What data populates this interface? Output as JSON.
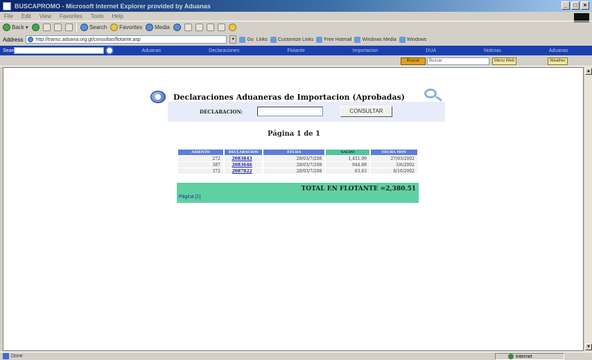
{
  "window": {
    "title": "BUSCAPROMO - Microsoft Internet Explorer provided by Aduanas"
  },
  "menu": [
    "File",
    "Edit",
    "View",
    "Favorites",
    "Tools",
    "Help"
  ],
  "toolbar": {
    "back_label": "Back",
    "search_label": "Search",
    "favorites_label": "Favorites",
    "media_label": "Media"
  },
  "address": {
    "label": "Address",
    "url": "http://transc.aduana.org.gt/consultas/flotante.asp",
    "go_label": "Go",
    "links_label": "Links",
    "links": [
      "Customize Links",
      "Free Hotmail",
      "Windows Media",
      "Windows"
    ]
  },
  "site_nav": {
    "search_label": "Search",
    "items": [
      "Aduanas",
      "Declaraciones",
      "Flotante",
      "Importacion",
      "DUA",
      "Noticias",
      "Aduanas"
    ]
  },
  "strip2": {
    "tag_label": "Buscar",
    "input_value": "Buscar",
    "options": [
      "Menu Web",
      "Weather"
    ]
  },
  "content": {
    "heading": "Declaraciones Aduaneras de Importacion (Aprobadas)",
    "form_label": "DECLARACION:",
    "input_value": "",
    "submit_label": "CONSULTAR",
    "pager_top": "Página 1 de 1",
    "table": {
      "headers": [
        "ASIENTO",
        "DECLARACION",
        "FECHA",
        "SALDO",
        "FECHA MOV"
      ],
      "rows": [
        [
          "272",
          "2083843",
          "28/03/7/208",
          "1,431.99",
          "27/03/2002"
        ],
        [
          "387",
          "2083646",
          "28/03/7/208",
          "944.89",
          "3/6/2002"
        ],
        [
          "372",
          "2087822",
          "28/03/7/208",
          "83.63",
          "8/10/2002"
        ]
      ]
    },
    "total_text": "TOTAL EN FLOTANTE =2,380.51",
    "pages_text": "Página [1]"
  },
  "status": {
    "text": "Done",
    "zone": "Internet"
  }
}
